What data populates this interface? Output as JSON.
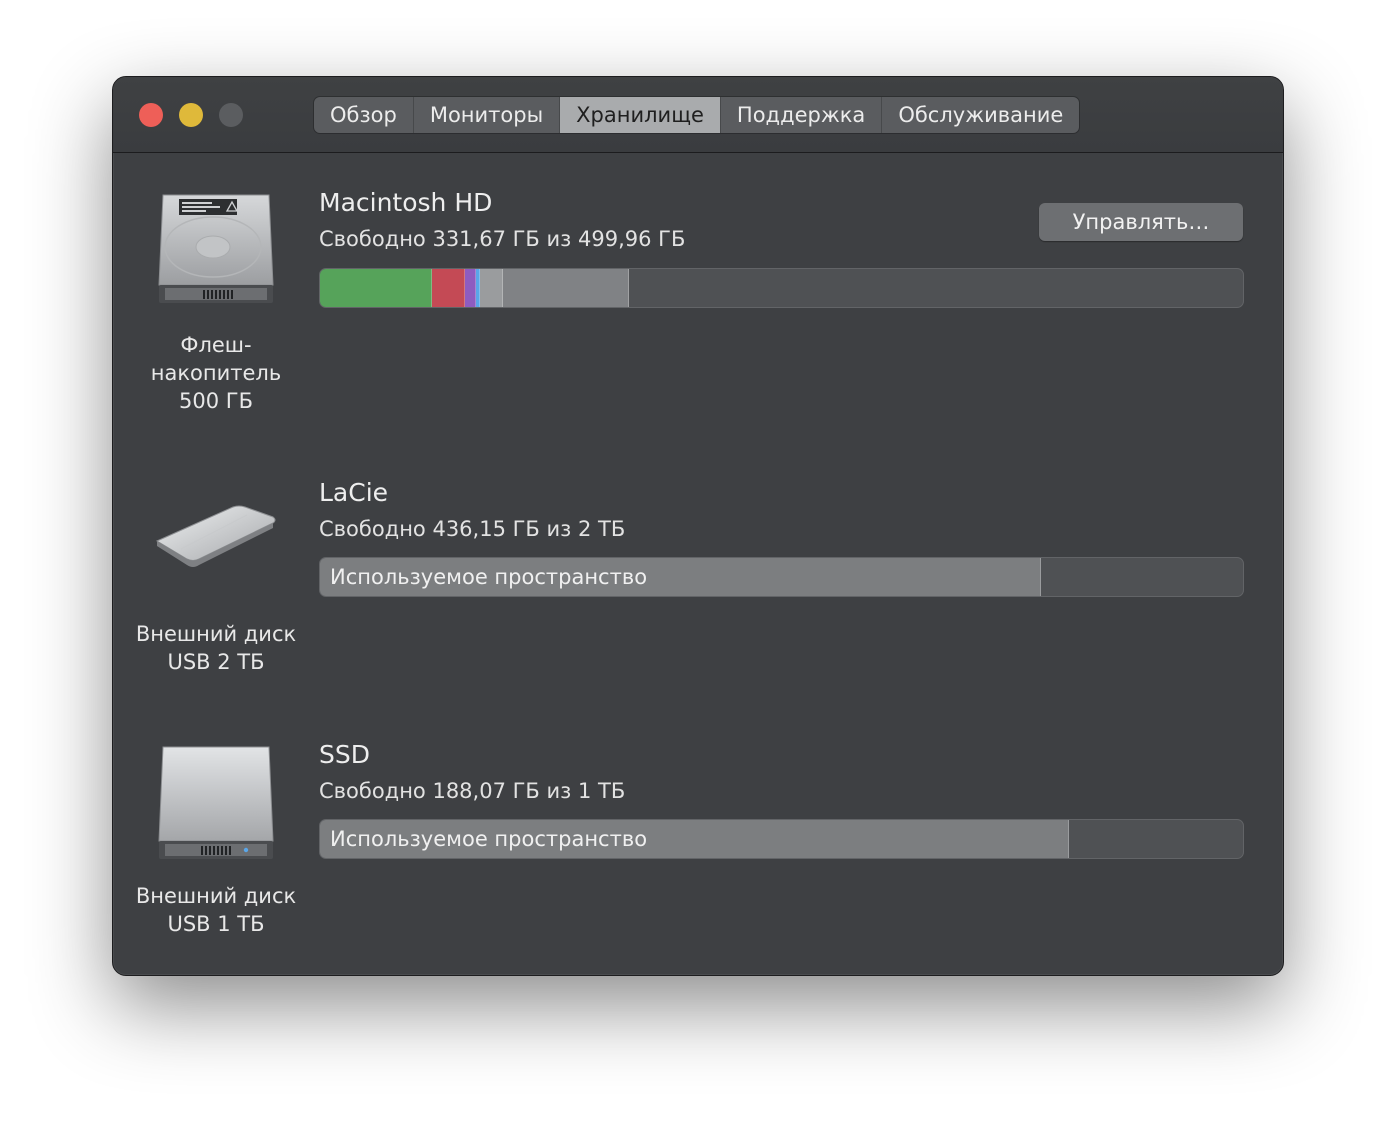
{
  "window": {
    "tabs": [
      {
        "label": "Обзор",
        "active": false
      },
      {
        "label": "Мониторы",
        "active": false
      },
      {
        "label": "Хранилище",
        "active": true
      },
      {
        "label": "Поддержка",
        "active": false
      },
      {
        "label": "Обслуживание",
        "active": false
      }
    ],
    "colors": {
      "close": "#ee5f58",
      "minimize": "#dfb93a",
      "zoom": "#5b5d60"
    }
  },
  "disks": [
    {
      "name": "Macintosh HD",
      "free_text": "Свободно 331,67 ГБ из 499,96 ГБ",
      "label": "Флеш-\nнакопитель\n500 ГБ",
      "icon": "internal-drive-icon",
      "manage_label": "Управлять…",
      "segments": [
        {
          "color": "#56a35a",
          "fraction": 0.121
        },
        {
          "color": "#c44a55",
          "fraction": 0.036
        },
        {
          "color": "#8e5cc0",
          "fraction": 0.012
        },
        {
          "color": "#5aa6e8",
          "fraction": 0.004
        },
        {
          "color": "#9a9c9e",
          "fraction": 0.025
        },
        {
          "color": "#808285",
          "fraction": 0.137
        }
      ]
    },
    {
      "name": "LaCie",
      "free_text": "Свободно 436,15 ГБ из 2 ТБ",
      "label": "Внешний диск\nUSB 2 ТБ",
      "icon": "portable-drive-icon",
      "used_label": "Используемое пространство",
      "used_fraction": 0.781
    },
    {
      "name": "SSD",
      "free_text": "Свободно 188,07 ГБ из 1 ТБ",
      "label": "Внешний диск\nUSB 1 ТБ",
      "icon": "external-drive-icon",
      "used_label": "Используемое пространство",
      "used_fraction": 0.812
    }
  ]
}
